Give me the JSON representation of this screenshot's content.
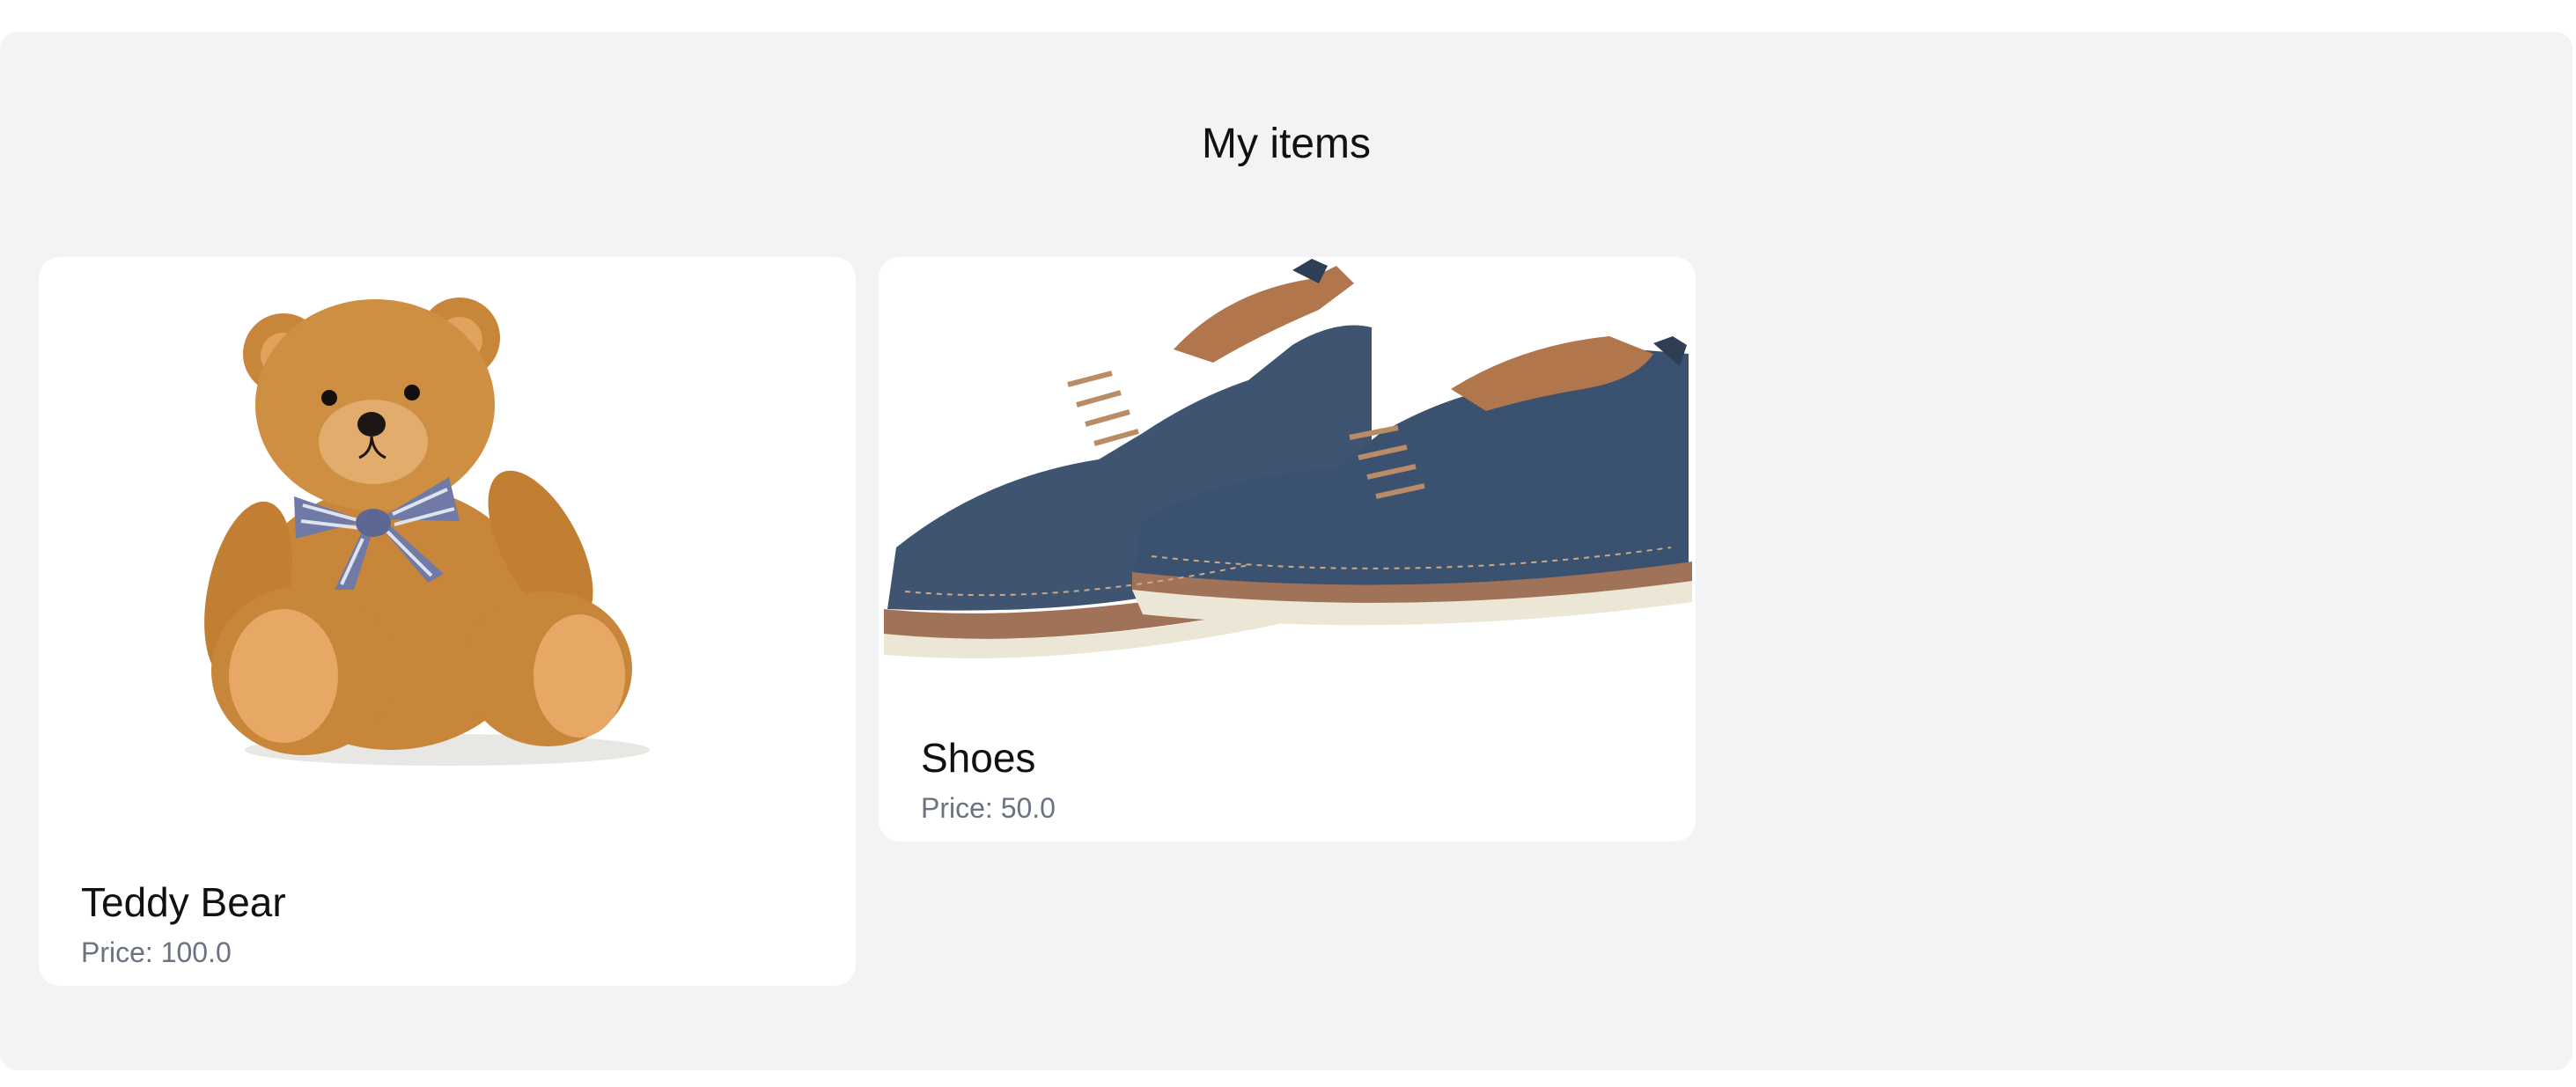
{
  "page": {
    "title": "My items"
  },
  "items": [
    {
      "name": "Teddy Bear",
      "price": "Price: 100.0",
      "image": "teddy-bear-photo"
    },
    {
      "name": "Shoes",
      "price": "Price: 50.0",
      "image": "shoes-photo"
    }
  ],
  "colors": {
    "page_background": "#ffffff",
    "panel_background": "#f2f3f5",
    "card_background": "#ffffff",
    "title_text": "#111111",
    "price_text": "#6b7280"
  }
}
